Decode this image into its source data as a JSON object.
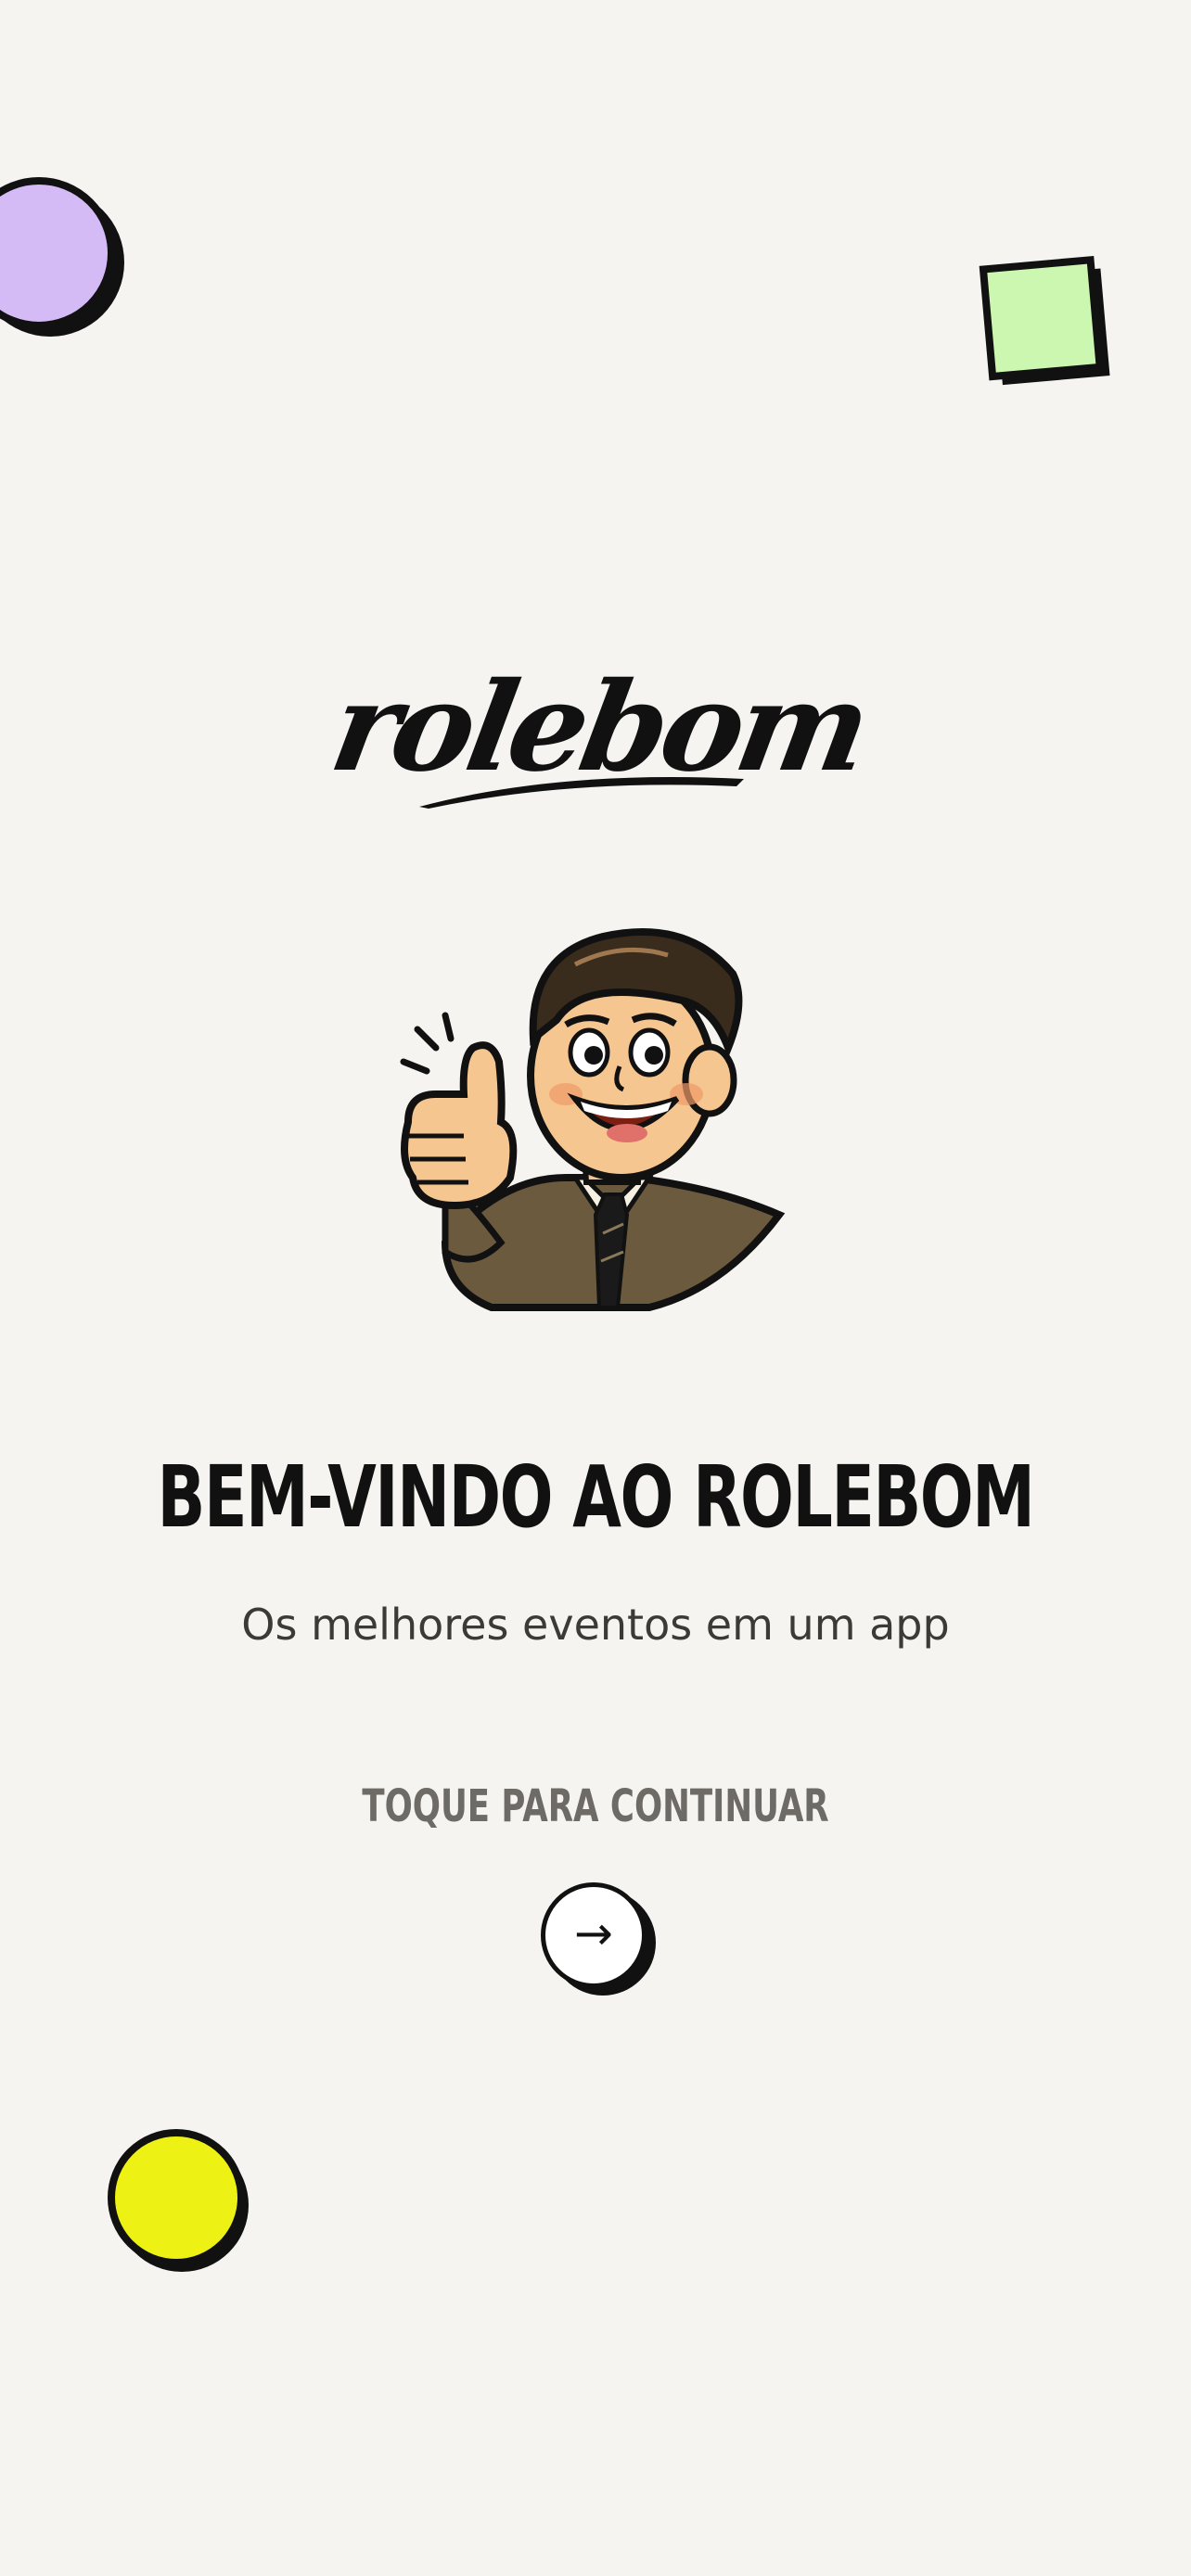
{
  "app": {
    "logo_text": "rolebom",
    "headline": "BEM-VINDO AO ROLEBOM",
    "subtitle": "Os melhores eventos em um app",
    "tap_hint": "TOQUE PARA CONTINUAR",
    "continue_icon": "→"
  },
  "icons": {
    "continue": "arrow-right-icon",
    "mascot": "thumbs-up-mascot"
  },
  "colors": {
    "background": "#f5f4f0",
    "purple_circle": "#d4bbf5",
    "green_square": "#ccf7b0",
    "yellow_circle": "#eef214",
    "text_dark": "#111111",
    "text_muted": "#6e6a66"
  }
}
